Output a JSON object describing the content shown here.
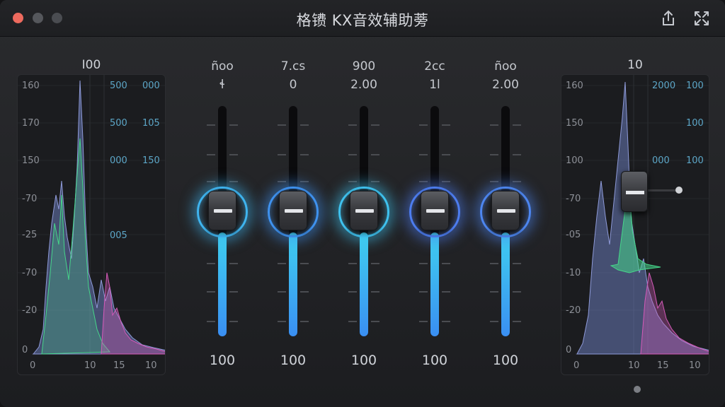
{
  "window": {
    "title": "格镄 KX音效辅助蒡",
    "traffic_colors": {
      "close": "#ed6a5e",
      "minimize": "#55575c",
      "maximize": "#4a4c51"
    },
    "toolbar_icons": [
      "share-icon",
      "expand-icon"
    ]
  },
  "left_panel": {
    "label": "I00",
    "y_labels": [
      "160",
      "170",
      "150",
      "-70",
      "-25",
      "-70",
      "-20",
      "0"
    ],
    "channel_labels": [
      {
        "a": "500",
        "b": "000"
      },
      {
        "a": "500",
        "b": "105"
      },
      {
        "a": "000",
        "b": "150"
      },
      {
        "a": "005",
        "b": ""
      }
    ],
    "x_labels": [
      "0",
      "10",
      "15",
      "10"
    ]
  },
  "right_panel": {
    "label": "10",
    "y_labels": [
      "160",
      "150",
      "100",
      "-70",
      "-05",
      "-10",
      "-20",
      "0"
    ],
    "channel_labels": [
      {
        "a": "2000",
        "b": "100"
      },
      {
        "a": "",
        "b": "100"
      },
      {
        "a": "000",
        "b": "100"
      }
    ],
    "x_labels": [
      "0",
      "10",
      "15",
      "10"
    ]
  },
  "faders": [
    {
      "name": "ñoo",
      "value": "ɬ",
      "bottom": "100",
      "level": 0.45,
      "glow": "#3fb4ef"
    },
    {
      "name": "7.cs",
      "value": "0",
      "bottom": "100",
      "level": 0.45,
      "glow": "#3f92ef"
    },
    {
      "name": "900",
      "value": "2.00",
      "bottom": "100",
      "level": 0.45,
      "glow": "#3fc2ef"
    },
    {
      "name": "2cc",
      "value": "1l",
      "bottom": "100",
      "level": 0.45,
      "glow": "#4d7df0"
    },
    {
      "name": "ñoo",
      "value": "2.00",
      "bottom": "100",
      "level": 0.45,
      "glow": "#4d86f0"
    }
  ],
  "colors": {
    "accent": "#3fd0ef",
    "accent2": "#3a8ff2",
    "histogram_green": "#46d68a",
    "histogram_pink": "#d45ab8",
    "histogram_blue": "#7a8ed6"
  }
}
